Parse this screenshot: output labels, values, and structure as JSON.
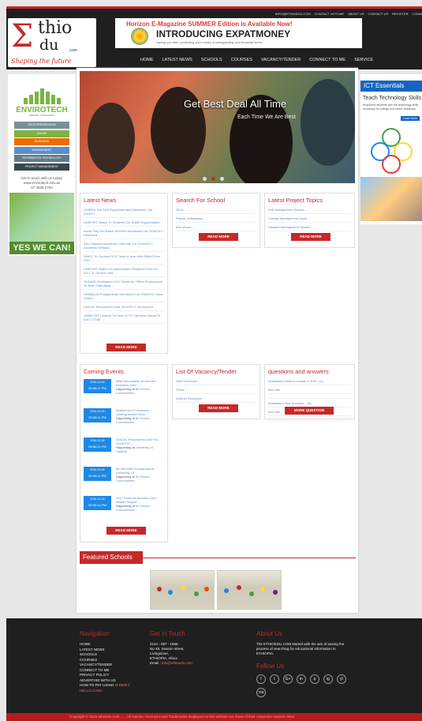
{
  "toplinks": [
    "info@ethioedu.com",
    "Contact Hotline",
    "About Us",
    "Contact Us",
    "Register",
    "Login"
  ],
  "logo": {
    "ethio": "thio",
    "du": "du",
    "com": ".com",
    "tagline": "Shaping the future"
  },
  "banner": {
    "top": "Horizon E-Magazine SUMMER Edition is Available Now!",
    "main": "INTRODUCING EXPATMONEY",
    "sub": "Saving you time, protecting your money & safeguarding your financial future."
  },
  "nav": [
    "Home",
    "Latest News",
    "Schools",
    "Courses",
    "Vacancy/Tender",
    "Connect to me",
    "Service"
  ],
  "left_ad": {
    "title": "ENVIROTECH",
    "subtitle": "Institute of Education",
    "menu": [
      {
        "label": "SSCE Preparation",
        "color": "#78909c"
      },
      {
        "label": "Online",
        "color": "#7cb342"
      },
      {
        "label": "Business",
        "color": "#ef6c00"
      },
      {
        "label": "Management",
        "color": "#5c8fc9"
      },
      {
        "label": "Information Technology",
        "color": "#607d8b"
      },
      {
        "label": "Project Management",
        "color": "#37474f"
      }
    ],
    "contact": [
      "Get in touch with us today!",
      "www.envirotech.edu.au",
      "07 3535 2700"
    ],
    "slogan": "YES WE CAN!"
  },
  "right_ad": {
    "head": "ICT Essentials",
    "title": "Teach Technology Skills",
    "body": "Empowers students with the technology skills necessary for college and career readiness.",
    "button": "Learn More"
  },
  "hero": {
    "title": "Get Best Deal All Time",
    "subtitle": "Each Time We Are Best",
    "slides": 3,
    "active_slide": 1
  },
  "latest_news": {
    "title": "Latest News",
    "items": [
      "UNIBEN 2nd SUB Supplementary Admission List 2016/17 ...",
      "UNIPORT Notice To Students On JAMB Regularisation ...",
      "Auchi Poly 2nd Batch ND/HND Admission List 2016/2017 Released ...",
      "AAU Adjusted Academic Calendar For 2016/2017 Academic Session ...",
      "WAEC To Conduct SCE Twice A Year With Effect From 2017 ...",
      "UNIPORT Notice On Matriculation Request Form For 2017 'A' Service Year ...",
      "TASUED Graduates 2,247 Students, Offers Employment To Best Graduating ...",
      "UNIABUJA Postgraduate Admission List 2016/2017 Now Online ...",
      "UNICAL Resumption Date 2016/2017 Announced ...",
      "JAMB CBT Centres To Face CCTV Cameras Ahead Of 2017 UTME ..."
    ],
    "button": "Read More"
  },
  "search_school": {
    "title": "Search For School",
    "items": [
      "SEVL ...",
      "Rikesh Vivfraadyss ...",
      "test school ..."
    ],
    "button": "Read More"
  },
  "project_topics": {
    "title": "Latest Project Topics",
    "items": [
      "Grill Management System ...",
      "College Management Syste ...",
      "Hospital Management System ..."
    ],
    "button": "Read More"
  },
  "events": {
    "title": "Coming Events",
    "items": [
      {
        "date": "2016-10-18",
        "time": "05:58:11 PM",
        "name": "MBA Scholarship At Harvard Business Scho ...",
        "place": "All School Communities"
      },
      {
        "date": "2016-10-18",
        "time": "05:58:11 PM",
        "name": "MasterCard Foundation Undergraduate Scho ...",
        "place": "All School Communities"
      },
      {
        "date": "2016-10-18",
        "time": "05:58:11 PM",
        "name": "UNICAL Resumption Date For 2016/2017 ...",
        "place": "University of Calabar"
      },
      {
        "date": "2016-10-18",
        "time": "05:58:11 PM",
        "name": "£5,000 MBA Scholarship At University Of ...",
        "place": "All School Communities"
      },
      {
        "date": "2016-10-18",
        "time": "05:52:44 PM",
        "name": "2017 Erasmus Mundus Joint Master Degree ...",
        "place": "All School Communities"
      }
    ],
    "happening_label": "Happening at",
    "button": "Read More"
  },
  "vacancy": {
    "title": "List Of Vacancy/Tender",
    "items": [
      "Web Developer ...",
      "Tester ...",
      "Android Developer ..."
    ],
    "button": "Read More"
  },
  "qa": {
    "title": "questions and answers",
    "items": [
      {
        "q": "Graduation What to include in PHP...(1)",
        "by": "dine this"
      },
      {
        "q": "Graduation Test Question... (0)",
        "by": "dine this"
      }
    ],
    "button": "More Question"
  },
  "featured": {
    "title": "Featured Schools"
  },
  "footer": {
    "nav_title": "Navigation",
    "nav_items": [
      "Home",
      "Latest News",
      "Schools",
      "Courses",
      "Vacancy/Tender",
      "Connect to me",
      "Privacy Policy",
      "Advertise with us"
    ],
    "pay_prefix": "How to pay using",
    "pay_link1": "m-BIRR",
    "pay_link2": "Hello Cash",
    "contact_title": "Get in Touch",
    "contact": [
      "2144 - 097 - 1566",
      "No 48, Season street,",
      "Livingstone,",
      "ETHIOPIA, Africa"
    ],
    "email_label": "Email :",
    "email": "info@ethioedu.com",
    "about_title": "About Us",
    "about_text": "The ETHIOEDU.COM started with the aim of easing the process of searching for educational information in ETHIOPIA.",
    "follow_title": "Follow Us",
    "socials": [
      "f",
      "t",
      "G+",
      "in",
      "p",
      "ig",
      "yt",
      "rss"
    ],
    "copyright": "Copyright © 2016 ethioedu.com.......  All Names, Acronyms and Trademarks displayed on this website are those of their respective owners. Best"
  }
}
